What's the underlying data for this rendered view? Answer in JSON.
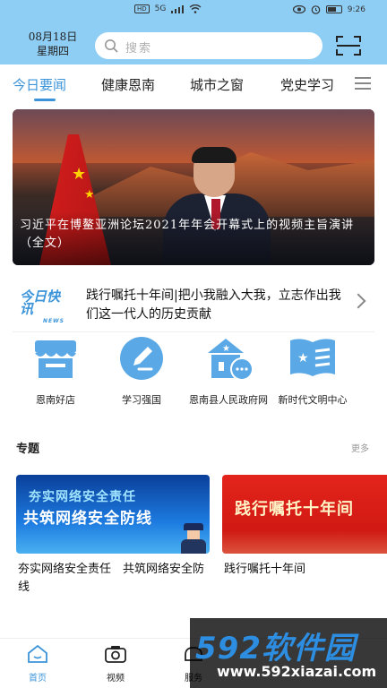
{
  "status_bar": {
    "network": "HD",
    "signal": "5G",
    "time": "9:26"
  },
  "header": {
    "date": "08月18日",
    "weekday": "星期四",
    "search_placeholder": "搜索"
  },
  "tabs": [
    {
      "label": "今日要闻",
      "active": true
    },
    {
      "label": "健康恩南",
      "active": false
    },
    {
      "label": "城市之窗",
      "active": false
    },
    {
      "label": "党史学习",
      "active": false
    }
  ],
  "hero": {
    "caption": "习近平在博鳌亚洲论坛2021年年会开幕式上的视频主旨演讲（全文）"
  },
  "news_flash": {
    "logo_main": "今日快讯",
    "logo_sub": "NEWS",
    "headline": "践行嘱托十年间|把小我融入大我，立志作出我们这一代人的历史贡献"
  },
  "quick_links": [
    {
      "label": "恩南好店",
      "icon": "storefront-icon"
    },
    {
      "label": "学习强国",
      "icon": "pen-icon"
    },
    {
      "label": "恩南县人民政府网",
      "icon": "government-building-icon"
    },
    {
      "label": "新时代文明中心",
      "icon": "book-star-icon"
    }
  ],
  "special": {
    "title": "专题",
    "more": "更多",
    "cards": [
      {
        "banner_line1": "夯实网络安全责任",
        "banner_line2": "共筑网络安全防线",
        "caption": "夯实网络安全责任　共筑网络安全防线"
      },
      {
        "banner_line1": "践行嘱托十年间",
        "caption": "践行嘱托十年间"
      }
    ]
  },
  "bottom_nav": [
    {
      "label": "首页",
      "icon": "home-icon",
      "active": true
    },
    {
      "label": "视频",
      "icon": "camera-icon",
      "active": false
    },
    {
      "label": "服务",
      "icon": "service-icon",
      "active": false
    }
  ],
  "watermark": {
    "brand": "592软件园",
    "url": "www.592xiazai.com"
  },
  "colors": {
    "header_bg": "#8ecdf4",
    "accent": "#3b94d9"
  }
}
